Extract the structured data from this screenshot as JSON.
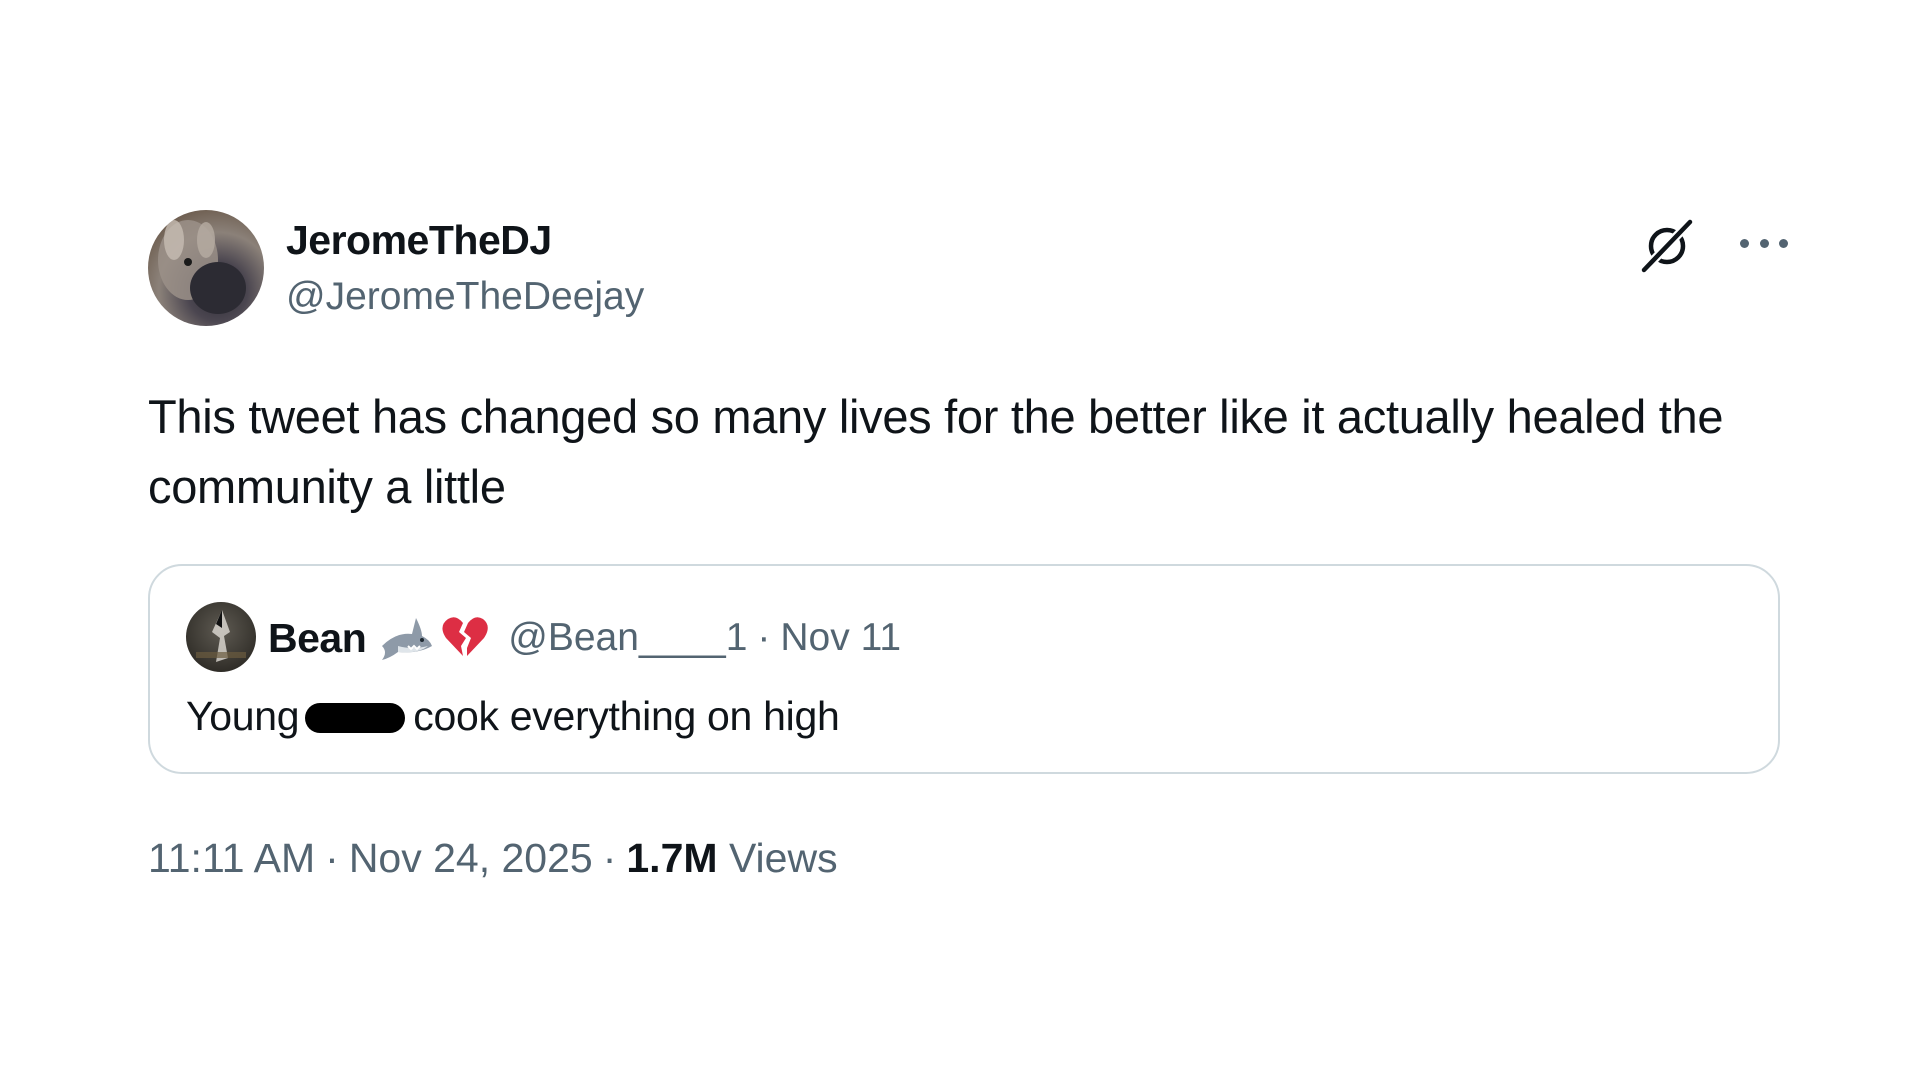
{
  "author": {
    "display_name": "JeromeTheDJ",
    "handle": "@JeromeTheDeejay"
  },
  "tweet": {
    "text": "This tweet has changed so many lives for the better like it actually healed the community a little"
  },
  "quoted_tweet": {
    "display_name": "Bean",
    "emojis": [
      "shark-emoji",
      "broken-heart-emoji"
    ],
    "handle": "@Bean____1",
    "separator": "·",
    "date": "Nov 11",
    "text_before": "Young",
    "text_after": "cook everything on high"
  },
  "meta": {
    "time": "11:11 AM",
    "separator": "·",
    "date": "Nov 24, 2025",
    "views_count": "1.7M",
    "views_label": "Views"
  },
  "icons": {
    "grok": "grok-icon",
    "more": "more-icon"
  },
  "colors": {
    "text_primary": "#0f1419",
    "text_secondary": "#536471",
    "border": "#cfd9de"
  }
}
